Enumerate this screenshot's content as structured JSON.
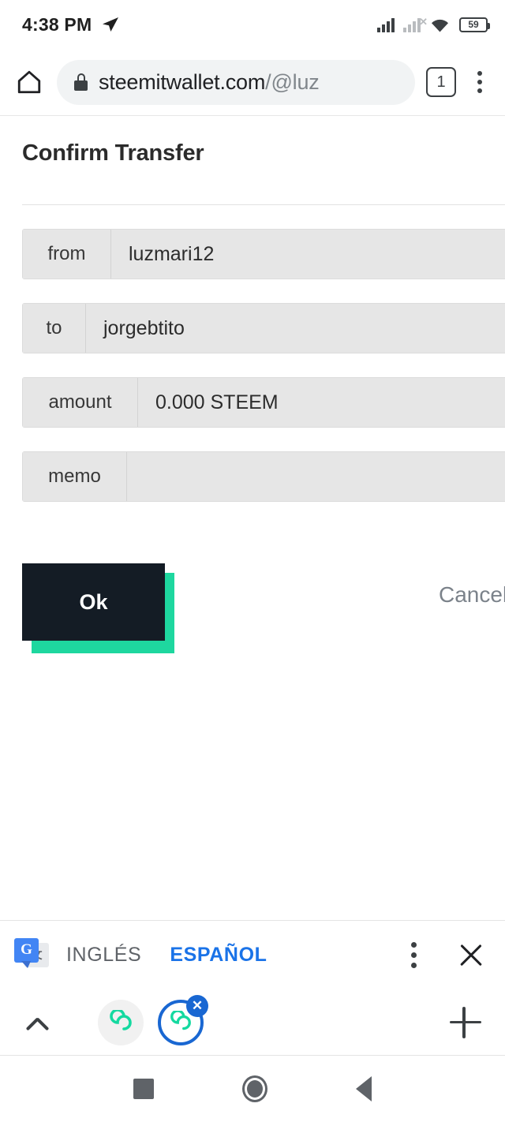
{
  "status_bar": {
    "clock": "4:38 PM",
    "location_icon": "navigation-arrow-icon",
    "signal_icon": "cellular-signal-icon",
    "signal_no_sim_icon": "cellular-no-sim-icon",
    "wifi_icon": "wifi-icon",
    "battery_level": "59"
  },
  "browser": {
    "home_icon": "home-icon",
    "lock_icon": "lock-icon",
    "url_domain": "steemitwallet.com",
    "url_path": "/@luz",
    "tab_count": "1",
    "menu_icon": "kebab-menu-icon"
  },
  "page": {
    "title": "Confirm Transfer",
    "fields": [
      {
        "label": "from",
        "value": "luzmari12"
      },
      {
        "label": "to",
        "value": "jorgebtito"
      },
      {
        "label": "amount",
        "value": "0.000 STEEM"
      },
      {
        "label": "memo",
        "value": ""
      }
    ],
    "ok_label": "Ok",
    "cancel_label": "Cancel",
    "accent_color": "#1ed79f",
    "button_color": "#141c25"
  },
  "translate_bar": {
    "icon": "google-translate-icon",
    "source_language": "INGLÉS",
    "target_language": "ESPAÑOL",
    "active_language": "ESPAÑOL",
    "menu_icon": "kebab-menu-icon",
    "close_icon": "close-icon",
    "accent_color": "#1a73e8"
  },
  "tab_strip": {
    "collapse_icon": "chevron-up-icon",
    "tabs": [
      {
        "name": "steem-tab-1",
        "icon": "steem-logo-icon",
        "active": false
      },
      {
        "name": "steem-tab-2",
        "icon": "steem-logo-icon",
        "active": true,
        "close_icon": "close-icon"
      }
    ],
    "add_tab_icon": "plus-icon"
  },
  "nav_bar": {
    "recents_icon": "square-recents-icon",
    "home_icon": "circle-home-icon",
    "back_icon": "triangle-back-icon"
  }
}
